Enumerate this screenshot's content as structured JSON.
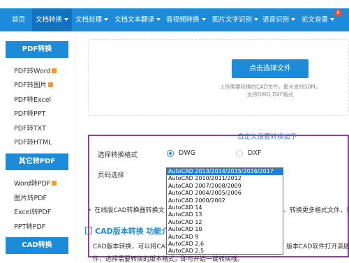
{
  "nav": {
    "home": "首页",
    "doc_convert": "文档转换",
    "doc_process": "文档处理",
    "doc_translate": "文档文本翻译",
    "audio_video": "音视频转换",
    "image_ocr": "图片文字识别",
    "voice_ocr": "语音识别",
    "paper_check": "论文查重",
    "paper_badge": "6"
  },
  "sidebar": {
    "pdf_head": "PDF转换",
    "pdf_items": [
      "PDF转Word",
      "PDF转图片",
      "PDF转Excel",
      "PDF转PPT",
      "PDF转TXT",
      "PDF转HTML"
    ],
    "other_head": "其它转PDF",
    "other_items": [
      "Word转PDF",
      "图片转PDF",
      "Excel转PDF",
      "PPT转PDF"
    ],
    "cad_head": "CAD转换"
  },
  "upload": {
    "button": "点击选择文件",
    "tip_line1": "上传需要转换的CAD文件，最大支持50M，",
    "tip_line2": "支持DWG,DXF格式"
  },
  "settings": {
    "custom_link": "自定义设置转换如下",
    "format_label": "选择转换格式",
    "format_dwg": "DWG",
    "format_dxf": "DXF",
    "version_label": "页码选择",
    "version_options": [
      "AutoCAD 2013/2014/2015/2016/2017",
      "AutoCAD 2010/2011/2012",
      "AutoCAD 2007/2008/2009",
      "AutoCAD 2004/2005/2006",
      "AutoCAD 2000/2002",
      "AutoCAD 14",
      "AutoCAD 13",
      "AutoCAD 12",
      "AutoCAD 10",
      "AutoCAD 9",
      "AutoCAD 2.6",
      "AutoCAD 2.5"
    ]
  },
  "info": {
    "line": "在线版CAD转换器转换文",
    "line_tail": "、转换更多格式文件，请"
  },
  "section": {
    "title": "CAD版本转换 功能介绍",
    "para1": "CAD版本转换，可以将CAD",
    "para1_tail": "版本CAD软件打开高版本",
    "para2": "件，选择需要转换的版本格式，即可开始一键转换哦。"
  }
}
